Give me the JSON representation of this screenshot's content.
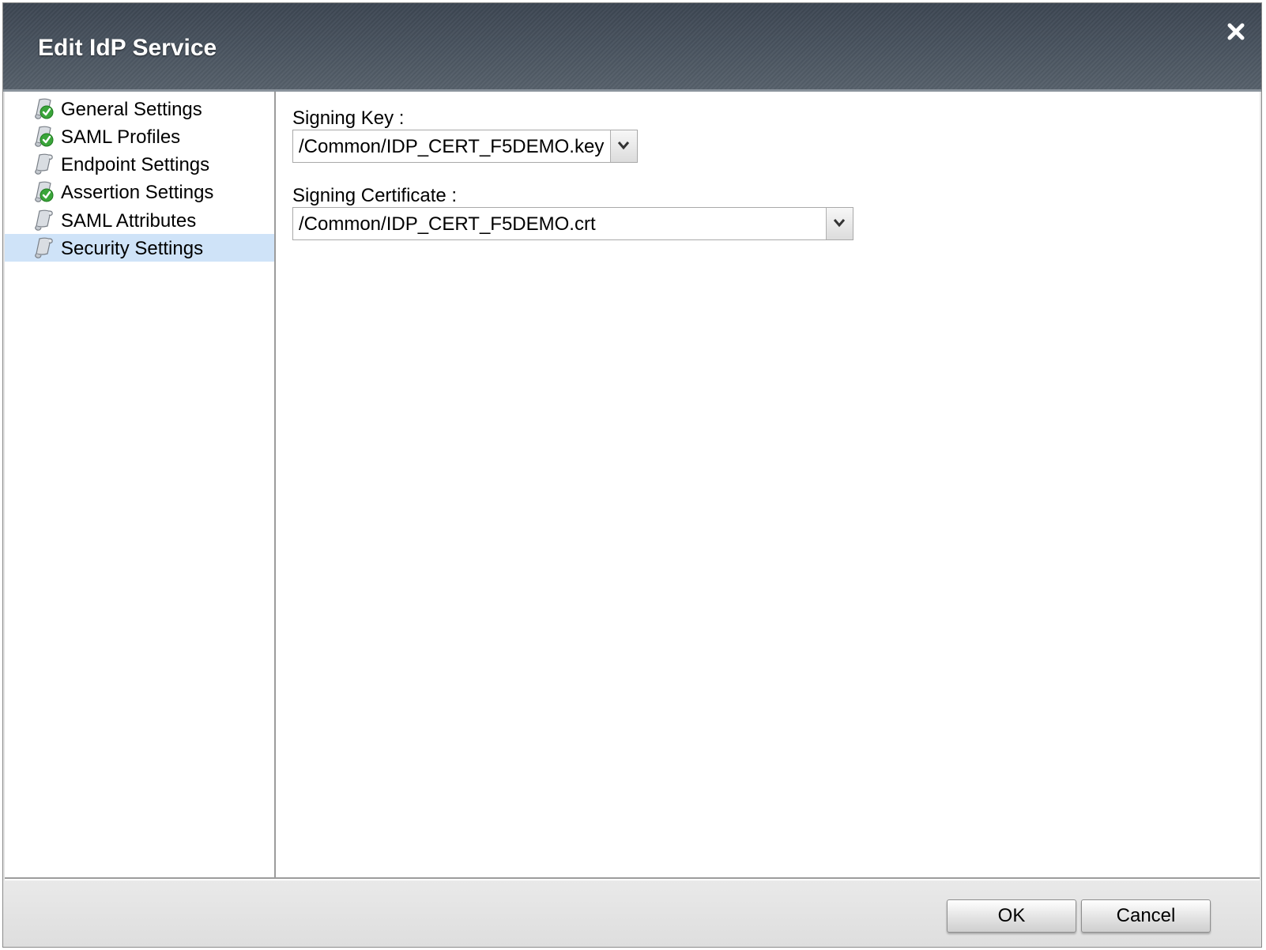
{
  "dialog": {
    "title": "Edit IdP Service",
    "close_icon": "close-icon"
  },
  "sidebar": {
    "items": [
      {
        "label": "General Settings",
        "icon": "scroll-check-icon",
        "completed": true,
        "active": false
      },
      {
        "label": "SAML Profiles",
        "icon": "scroll-check-icon",
        "completed": true,
        "active": false
      },
      {
        "label": "Endpoint Settings",
        "icon": "scroll-icon",
        "completed": false,
        "active": false
      },
      {
        "label": "Assertion Settings",
        "icon": "scroll-check-icon",
        "completed": true,
        "active": false
      },
      {
        "label": "SAML Attributes",
        "icon": "scroll-icon",
        "completed": false,
        "active": false
      },
      {
        "label": "Security Settings",
        "icon": "scroll-icon",
        "completed": false,
        "active": true
      }
    ]
  },
  "form": {
    "signing_key": {
      "label": "Signing Key :",
      "value": "/Common/IDP_CERT_F5DEMO.key"
    },
    "signing_certificate": {
      "label": "Signing Certificate :",
      "value": "/Common/IDP_CERT_F5DEMO.crt"
    }
  },
  "footer": {
    "ok_label": "OK",
    "cancel_label": "Cancel"
  },
  "colors": {
    "titlebar": "#4a545f",
    "active_item": "#cfe3f8",
    "check_green": "#3aa53a"
  }
}
